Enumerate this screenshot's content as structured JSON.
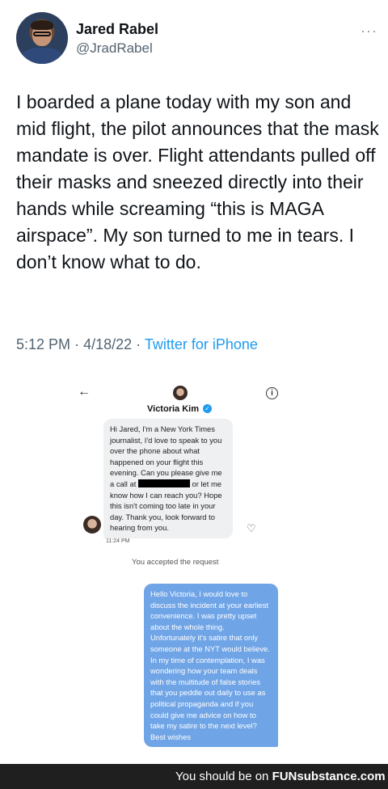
{
  "tweet": {
    "author_name": "Jared Rabel",
    "author_handle": "@JradRabel",
    "more_icon": "ellipsis-icon",
    "text": "I boarded a plane today with my son and mid flight, the pilot announces that the mask mandate is over. Flight attendants pulled off their masks and sneezed directly into their hands while screaming “this is MAGA airspace”. My son turned to me in tears. I don’t know what to do.",
    "time": "5:12 PM",
    "sep1": "·",
    "date": "4/18/22",
    "sep2": "·",
    "source": "Twitter for iPhone",
    "source_color": "#1d9bf0"
  },
  "dm": {
    "back_icon": "back-arrow-icon",
    "back_glyph": "←",
    "info_icon": "info-icon",
    "info_glyph": "i",
    "contact_name": "Victoria Kim",
    "verified_icon": "verified-badge-icon",
    "verified_glyph": "✓",
    "incoming_message_before_redaction": "Hi Jared, I'm a New York Times journalist, I'd love to speak to you over the phone about what happened on your flight this evening. Can you please give me a call at",
    "incoming_message_after_redaction": "or let me know how I can reach you? Hope this isn't coming too late in your day. Thank you, look forward to hearing from you.",
    "incoming_time": "11:24 PM",
    "react_icon": "heart-plus-icon",
    "react_glyph": "♡",
    "accepted_text": "You accepted the request",
    "outgoing_message": "Hello Victoria, I would love to discuss the incident at your earliest convenience. I was pretty upset about the whole thing. Unfortunately it's satire that only someone at the NYT would believe. In my time of contemplation, I was wondering how your team deals with the multitude of false stories that you peddle out daily to use as political propaganda and if you could give me advice on how to take my satire to the next level? Best wishes",
    "outgoing_bubble_color": "#6fa4e6"
  },
  "footer": {
    "prefix": "You should be on",
    "brand": "FUNsubstance.com"
  }
}
